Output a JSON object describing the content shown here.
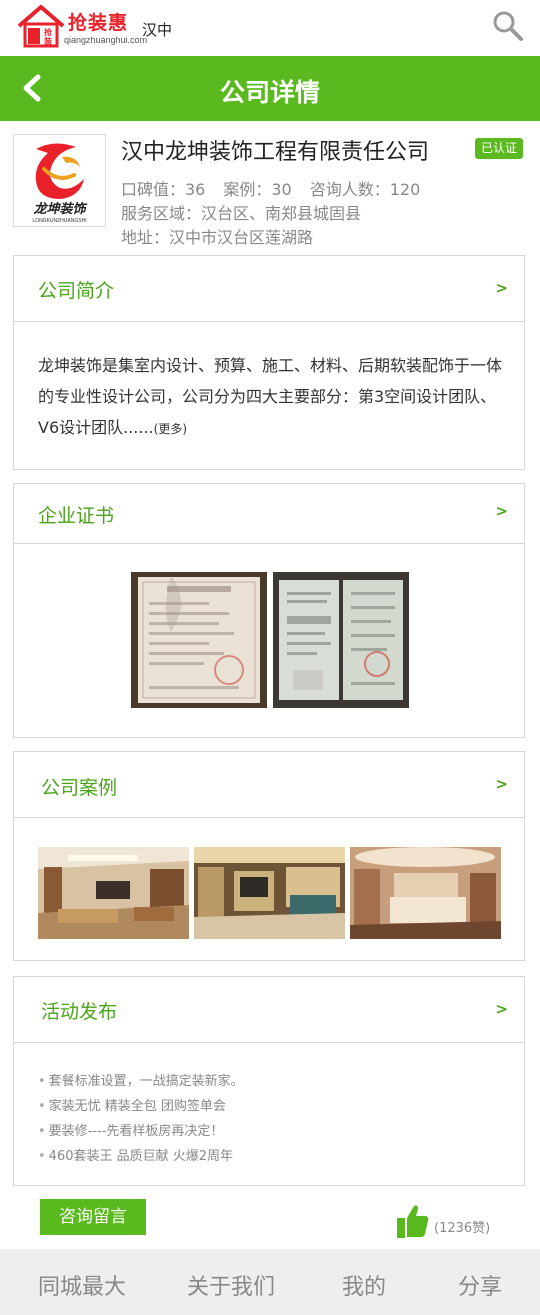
{
  "topbar": {
    "brand": "抢装惠",
    "logo_house_text": "抢装惠",
    "domain": "qiangzhuanghui.com",
    "city": "汉中",
    "search_icon": "search-icon"
  },
  "header": {
    "title": "公司详情",
    "back_icon": "chevron-left-icon"
  },
  "company": {
    "name": "汉中龙坤装饰工程有限责任公司",
    "verified": "已认证",
    "logo_text": "龙坤装饰",
    "logo_subtext": "LONGKUNZHUANGSHI",
    "reputation": "口碑值：36",
    "cases": "案例：30",
    "consultants": "咨询人数：120",
    "area": "服务区域：汉台区、南郑县城固县",
    "address": "地址：汉中市汉台区莲湖路"
  },
  "sections": {
    "intro": {
      "title": "公司简介",
      "arrow": ">",
      "text": "龙坤装饰是集室内设计、预算、施工、材料、后期软装配饰于一体的专业性设计公司，公司分为四大主要部分：第3空间设计团队、V6设计团队......",
      "more": "(更多)"
    },
    "certs": {
      "title": "企业证书",
      "arrow": ">"
    },
    "cases": {
      "title": "公司案例",
      "arrow": ">"
    },
    "activity": {
      "title": "活动发布",
      "arrow": ">",
      "items": [
        "套餐标准设置，一战搞定装新家。",
        "家装无忧  精装全包  团购签单会",
        "要装修----先看样板房再决定！",
        "460套装王  品质巨献  火爆2周年"
      ]
    }
  },
  "actions": {
    "consult": "咨询留言",
    "like_icon": "thumbs-up-icon",
    "like_count": "(1236赞)"
  },
  "footer": {
    "items": [
      "同城最大",
      "关于我们",
      "我的",
      "分享"
    ]
  },
  "colors": {
    "brand_green": "#5ab91e",
    "title_green": "#4aa51a",
    "logo_red": "#e8212b"
  }
}
